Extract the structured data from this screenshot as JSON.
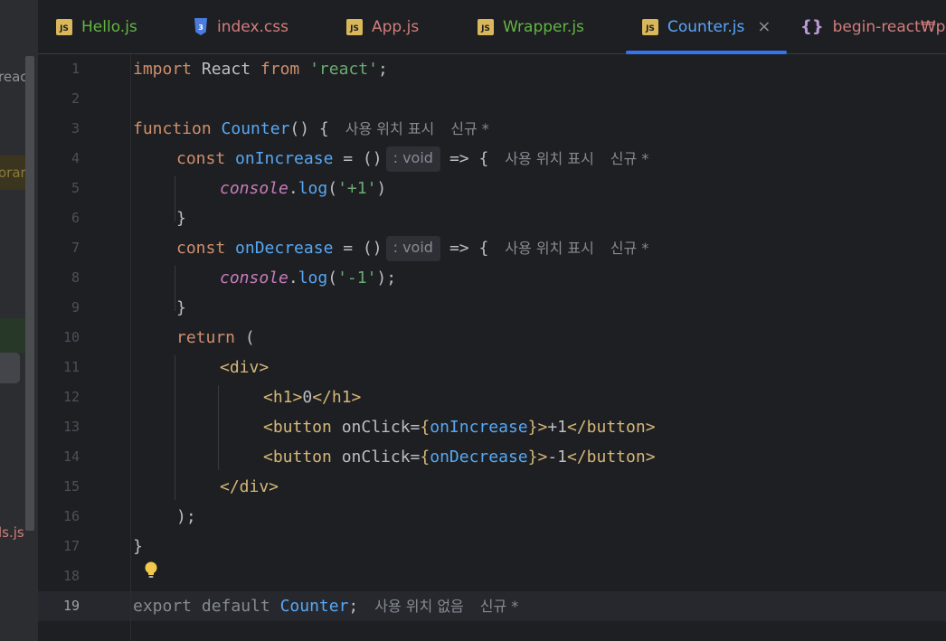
{
  "left_panel": {
    "fragments": [
      "react",
      "orary",
      "ls.js"
    ]
  },
  "tabs": [
    {
      "label": "Hello.js",
      "icon": "js-file-icon",
      "color": "#62b543"
    },
    {
      "label": "index.css",
      "icon": "css-file-icon",
      "color": "#d27d7d"
    },
    {
      "label": "App.js",
      "icon": "js-file-icon",
      "color": "#d27d7d"
    },
    {
      "label": "Wrapper.js",
      "icon": "js-file-icon",
      "color": "#62b543"
    },
    {
      "label": "Counter.js",
      "icon": "js-file-icon",
      "color": "#58a6ff",
      "active": true
    },
    {
      "label": "begin-react₩pac",
      "icon": "json-file-icon",
      "color": "#d27d7d"
    }
  ],
  "icons": {
    "js": "JS",
    "json": "{}",
    "close": "×"
  },
  "hints": {
    "usages": "사용 위치 표시",
    "new": "신규 *",
    "no_usages": "사용 위치 없음",
    "void_type": ": void"
  },
  "editor": {
    "current_line": 19,
    "line_numbers": [
      "1",
      "2",
      "3",
      "4",
      "5",
      "6",
      "7",
      "8",
      "9",
      "10",
      "11",
      "12",
      "13",
      "14",
      "15",
      "16",
      "17",
      "18",
      "19"
    ],
    "lines": {
      "l1": [
        "import",
        " React ",
        "from",
        " ",
        "'react'",
        ";"
      ],
      "l3": [
        "function",
        " ",
        "Counter",
        "() {"
      ],
      "l4": [
        "const",
        " ",
        "onIncrease",
        " = ()",
        "=> {"
      ],
      "l5": [
        "console",
        ".",
        "log",
        "(",
        "'+1'",
        ")"
      ],
      "l6": [
        "}"
      ],
      "l7": [
        "const",
        " ",
        "onDecrease",
        " = ()",
        "=> {"
      ],
      "l8": [
        "console",
        ".",
        "log",
        "(",
        "'-1'",
        ");"
      ],
      "l9": [
        "}"
      ],
      "l10": [
        "return",
        " ("
      ],
      "l11": [
        "<div>"
      ],
      "l12": [
        "<h1>",
        "0",
        "</h1>"
      ],
      "l13": [
        "<button",
        " onClick=",
        "{",
        "onIncrease",
        "}",
        ">",
        "+1",
        "</button>"
      ],
      "l14": [
        "<button",
        " onClick=",
        "{",
        "onDecrease",
        "}",
        ">",
        "-1",
        "</button>"
      ],
      "l15": [
        "</div>"
      ],
      "l16": [
        ");"
      ],
      "l17": [
        "}"
      ],
      "l19": [
        "export default ",
        "Counter",
        ";"
      ]
    }
  },
  "colors": {
    "keyword": "#cf8e6d",
    "string": "#6aab73",
    "function": "#56a8f5",
    "tag": "#d5b778",
    "global": "#c77dbb",
    "accent": "#3574f0"
  }
}
